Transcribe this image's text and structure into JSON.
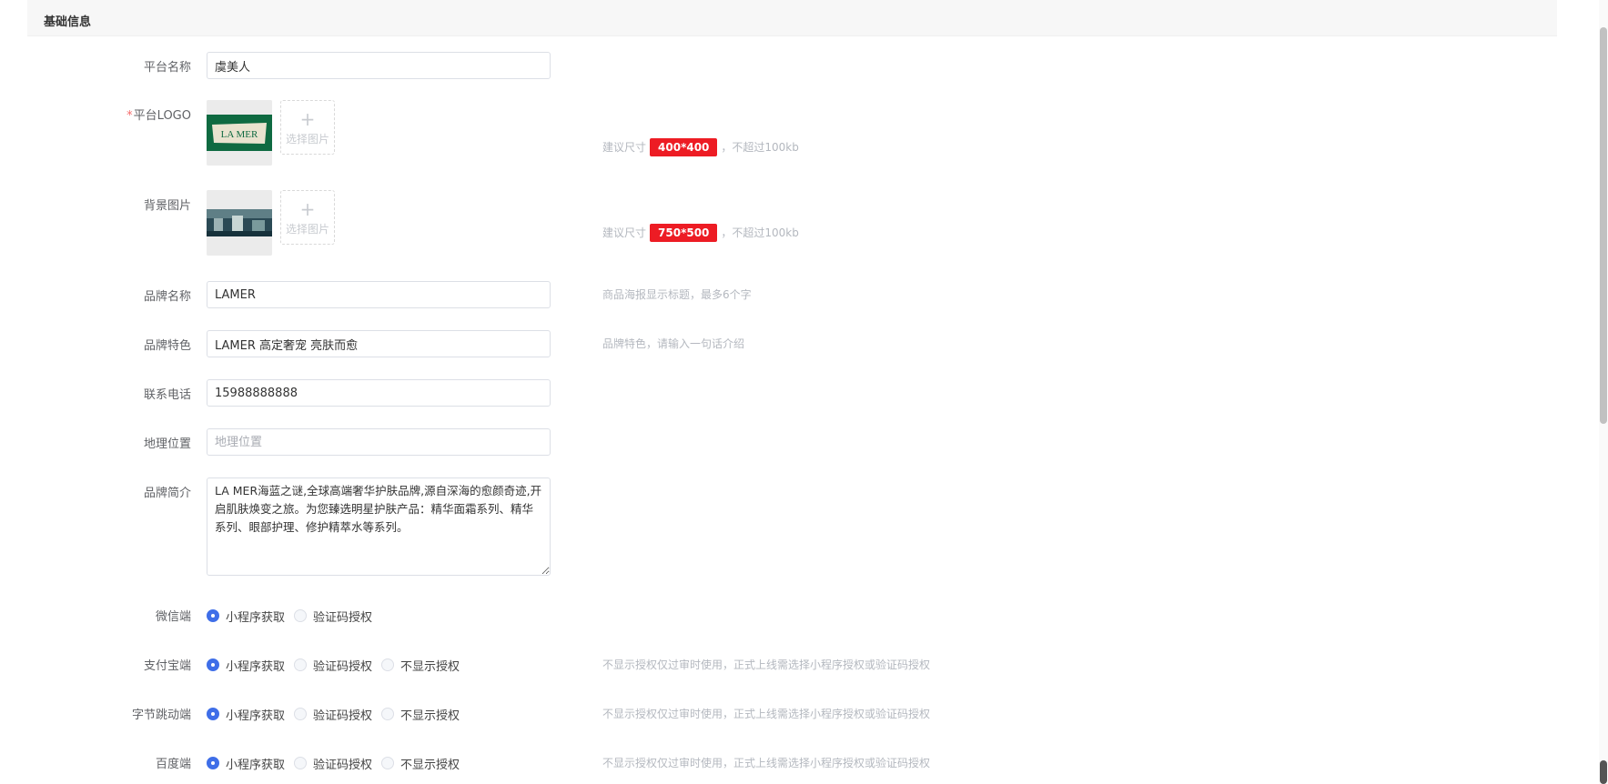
{
  "section": {
    "title": "基础信息"
  },
  "fields": {
    "platform_name": {
      "label": "平台名称",
      "value": "虞美人"
    },
    "platform_logo": {
      "label": "平台LOGO",
      "required_mark": "*",
      "upload_text": "选择图片",
      "upload_icon": "plus-icon",
      "thumb_text": "LA MER",
      "hint_prefix": "建议尺寸",
      "hint_size": "400*400",
      "hint_suffix": "，不超过100kb"
    },
    "background_image": {
      "label": "背景图片",
      "upload_text": "选择图片",
      "upload_icon": "plus-icon",
      "hint_prefix": "建议尺寸",
      "hint_size": "750*500",
      "hint_suffix": "，不超过100kb"
    },
    "brand_name": {
      "label": "品牌名称",
      "value": "LAMER",
      "hint": "商品海报显示标题，最多6个字"
    },
    "brand_feature": {
      "label": "品牌特色",
      "value": "LAMER 高定奢宠 亮肤而愈",
      "hint": "品牌特色，请输入一句话介绍"
    },
    "phone": {
      "label": "联系电话",
      "value": "15988888888"
    },
    "location": {
      "label": "地理位置",
      "value": "",
      "placeholder": "地理位置"
    },
    "brand_intro": {
      "label": "品牌简介",
      "value": "LA MER海蓝之谜,全球高端奢华护肤品牌,源自深海的愈颜奇迹,开启肌肤焕变之旅。为您臻选明星护肤产品：精华面霜系列、精华系列、眼部护理、修护精萃水等系列。"
    },
    "wechat": {
      "label": "微信端",
      "options": [
        "小程序获取",
        "验证码授权"
      ],
      "selected": "小程序获取"
    },
    "alipay": {
      "label": "支付宝端",
      "options": [
        "小程序获取",
        "验证码授权",
        "不显示授权"
      ],
      "selected": "小程序获取",
      "hint": "不显示授权仅过审时使用，正式上线需选择小程序授权或验证码授权"
    },
    "bytedance": {
      "label": "字节跳动端",
      "options": [
        "小程序获取",
        "验证码授权",
        "不显示授权"
      ],
      "selected": "小程序获取",
      "hint": "不显示授权仅过审时使用，正式上线需选择小程序授权或验证码授权"
    },
    "baidu": {
      "label": "百度端",
      "options": [
        "小程序获取",
        "验证码授权",
        "不显示授权"
      ],
      "selected": "小程序获取",
      "hint": "不显示授权仅过审时使用，正式上线需选择小程序授权或验证码授权"
    }
  },
  "colors": {
    "accent": "#3f6ee8",
    "badge": "#ed1c24",
    "required": "#f56c6c",
    "logo_green": "#0f6a41"
  }
}
